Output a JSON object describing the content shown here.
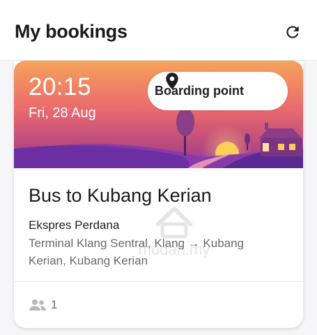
{
  "header": {
    "title": "My bookings",
    "refresh_icon": "refresh-icon"
  },
  "booking": {
    "time": "20:15",
    "date": "Fri, 28 Aug",
    "boarding_point_label": "Boarding point",
    "route_title": "Bus to Kubang Kerian",
    "operator": "Ekspres Perdana",
    "stations": "Terminal Klang Sentral, Klang → Kubang Kerian, Kubang Kerian",
    "passengers": "1",
    "passengers_icon": "people-icon",
    "pin_icon": "map-pin-icon"
  },
  "watermark": {
    "text": "mudah.my"
  },
  "colors": {
    "banner_top": "#f3a25e",
    "banner_mid": "#e0577a",
    "banner_bottom": "#7b3fb5",
    "hill": "#6b2fa3",
    "sun": "#ffd060"
  }
}
